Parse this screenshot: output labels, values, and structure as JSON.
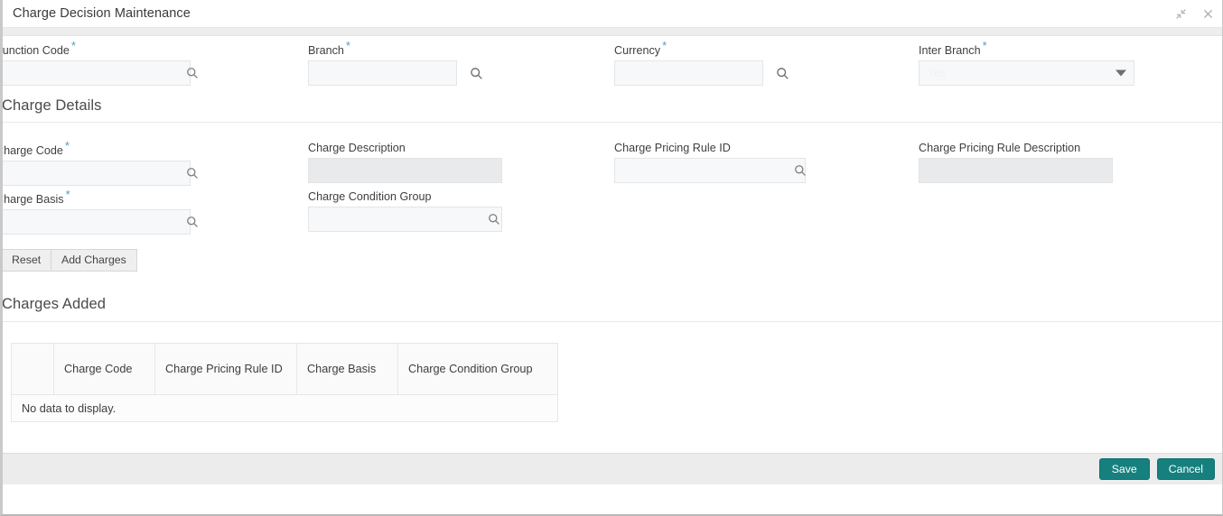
{
  "window": {
    "title": "Charge Decision Maintenance",
    "minimize_icon": "collapse-arrows-icon",
    "close_icon": "close-icon"
  },
  "top_fields": [
    {
      "label": "Function Code",
      "required": true,
      "value": "",
      "placeholder": "",
      "control": "lookup-inline",
      "focused": true
    },
    {
      "label": "Branch",
      "required": true,
      "value": "",
      "placeholder": "",
      "control": "lookup-outside",
      "focused": false
    },
    {
      "label": "Currency",
      "required": true,
      "value": "",
      "placeholder": "",
      "control": "lookup-outside",
      "focused": false
    },
    {
      "label": "Inter Branch",
      "required": true,
      "value": "Yes",
      "control": "select",
      "focused": false
    }
  ],
  "charge_details": {
    "heading": "Charge Details",
    "fields": [
      {
        "label": "Charge Code",
        "required": true,
        "value": "",
        "control": "lookup-inline"
      },
      {
        "label": "Charge Description",
        "required": false,
        "value": "",
        "control": "readonly"
      },
      {
        "label": "Charge Pricing Rule ID",
        "required": false,
        "value": "",
        "control": "lookup-inline"
      },
      {
        "label": "Charge Pricing Rule Description",
        "required": false,
        "value": "",
        "control": "readonly"
      },
      {
        "label": "Charge Basis",
        "required": true,
        "value": "",
        "control": "lookup-inline"
      },
      {
        "label": "Charge Condition Group",
        "required": false,
        "value": "",
        "control": "lookup-inline"
      }
    ],
    "reset_label": "Reset",
    "add_charges_label": "Add Charges"
  },
  "charges_added": {
    "heading": "Charges Added",
    "columns": [
      "",
      "Charge Code",
      "Charge Pricing Rule ID",
      "Charge Basis",
      "Charge Condition Group"
    ],
    "rows": [],
    "empty_message": "No data to display."
  },
  "footer": {
    "save_label": "Save",
    "cancel_label": "Cancel",
    "accent_color": "#16807e"
  }
}
